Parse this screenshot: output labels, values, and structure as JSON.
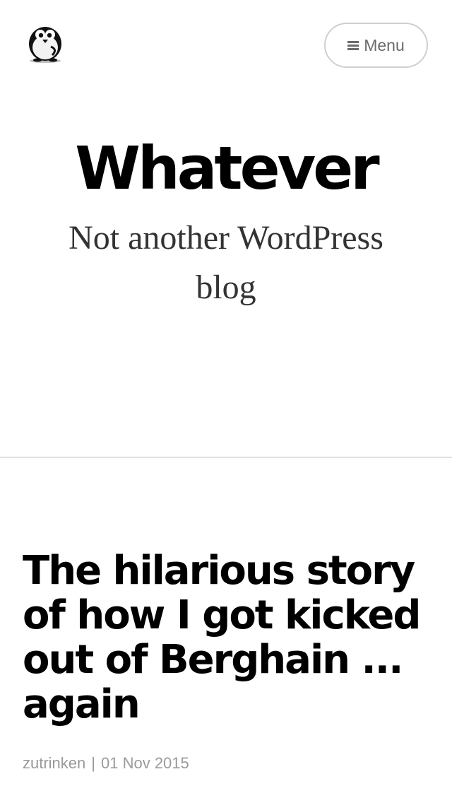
{
  "header": {
    "logo_icon": "penguin-icon",
    "menu_label": "Menu",
    "menu_icon": "hamburger-icon"
  },
  "site": {
    "title": "Whatever",
    "tagline": "Not another WordPress blog"
  },
  "post": {
    "title": "The hilarious story of how I got kicked out of Berghain ... again",
    "author": "zutrinken",
    "separator": "|",
    "date": "01 Nov 2015"
  },
  "colors": {
    "background": "#ffffff",
    "title": "#000000",
    "tagline": "#333333",
    "meta": "#9a9a9a",
    "border": "#cfcfcf"
  }
}
